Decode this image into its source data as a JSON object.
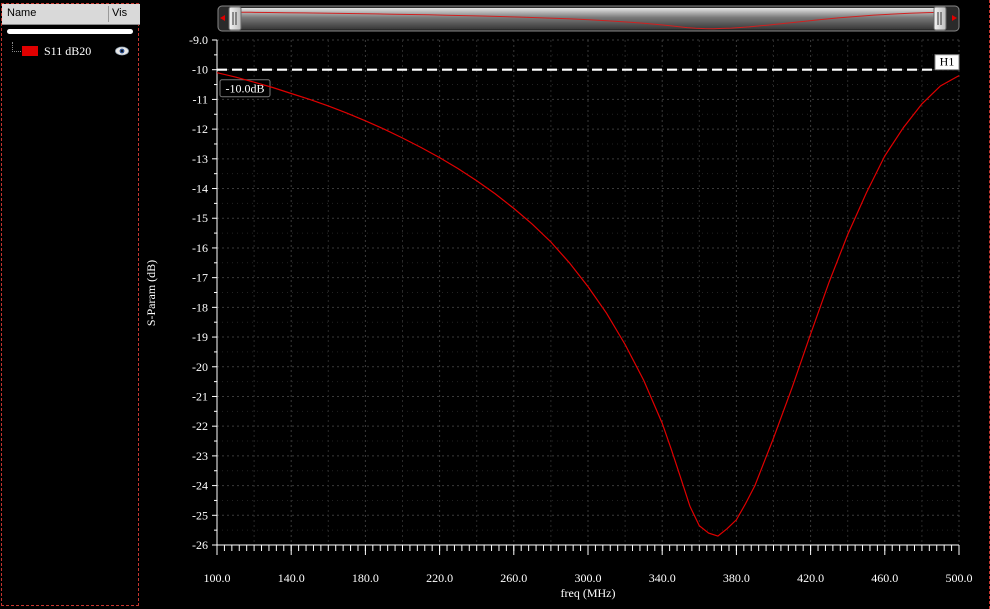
{
  "panel": {
    "header_name": "Name",
    "header_vis": "Vis",
    "traces": [
      {
        "label": "S11 dB20",
        "color": "#e00000",
        "visible": true
      }
    ]
  },
  "marker": {
    "name": "H1",
    "value": -10.0,
    "label": "-10.0dB"
  },
  "chart_data": {
    "type": "line",
    "xlabel": "freq (MHz)",
    "ylabel": "S-Param (dB)",
    "xlim": [
      100,
      500
    ],
    "ylim": [
      -26,
      -9
    ],
    "x_ticks": [
      "100.0",
      "140.0",
      "180.0",
      "220.0",
      "260.0",
      "300.0",
      "340.0",
      "380.0",
      "420.0",
      "460.0",
      "500.0"
    ],
    "y_ticks": [
      "-9.0",
      "-10",
      "-11",
      "-12",
      "-13",
      "-14",
      "-15",
      "-16",
      "-17",
      "-18",
      "-19",
      "-20",
      "-21",
      "-22",
      "-23",
      "-24",
      "-25",
      "-26"
    ],
    "grid": true,
    "series": [
      {
        "name": "S11 dB20",
        "color": "#e00000",
        "x": [
          100,
          110,
          120,
          130,
          140,
          150,
          160,
          170,
          180,
          190,
          200,
          210,
          220,
          230,
          240,
          250,
          260,
          270,
          280,
          290,
          300,
          310,
          320,
          330,
          340,
          345,
          350,
          355,
          360,
          365,
          370,
          375,
          380,
          385,
          390,
          395,
          400,
          410,
          420,
          430,
          440,
          450,
          460,
          470,
          480,
          490,
          500
        ],
        "y": [
          -10.1,
          -10.25,
          -10.42,
          -10.6,
          -10.8,
          -11.0,
          -11.22,
          -11.46,
          -11.72,
          -12.0,
          -12.3,
          -12.62,
          -12.96,
          -13.33,
          -13.74,
          -14.18,
          -14.67,
          -15.2,
          -15.8,
          -16.5,
          -17.3,
          -18.2,
          -19.25,
          -20.45,
          -21.9,
          -22.8,
          -23.75,
          -24.7,
          -25.35,
          -25.6,
          -25.7,
          -25.45,
          -25.15,
          -24.6,
          -24.0,
          -23.2,
          -22.4,
          -20.7,
          -18.9,
          -17.15,
          -15.55,
          -14.15,
          -12.9,
          -11.95,
          -11.15,
          -10.55,
          -10.2
        ]
      }
    ],
    "overview_slider": {
      "start": 0.0,
      "end": 1.0
    }
  }
}
